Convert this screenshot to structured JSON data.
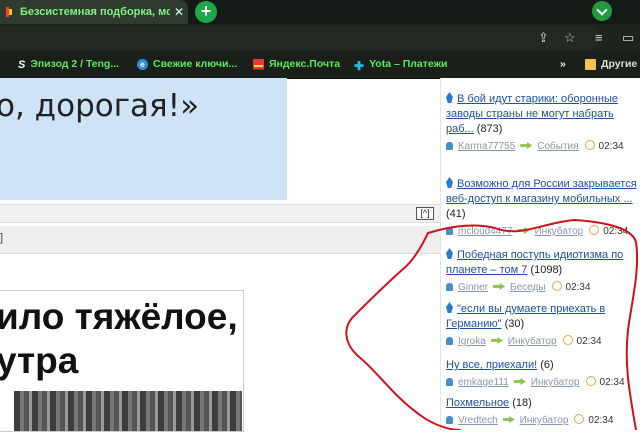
{
  "tab": {
    "title": "Безсистемная подборка, мо",
    "close": "✕"
  },
  "newtab": "+",
  "bookmarks": [
    {
      "label": "Эпизод 2 / Teng...",
      "icon": "s-icon"
    },
    {
      "label": "Свежие ключи...",
      "icon": "e-icon"
    },
    {
      "label": "Яндекс.Почта",
      "icon": "mail-icon"
    },
    {
      "label": "Yota – Платежи",
      "icon": "yota-icon"
    }
  ],
  "bookmarks_more": "»",
  "bookmarks_other": "Другие",
  "left": {
    "banner_text": "о, дорогая!»",
    "collapse": "[^]",
    "bracket": "]",
    "image_caption_line1": "ило тяжёлое,",
    "image_caption_line2": "утра"
  },
  "sidebar": {
    "items": [
      {
        "title": "В бой идут старики: оборонные заводы страны не могут набрать раб...",
        "count": "(873)",
        "user": "Karma77755",
        "category": "События",
        "time": "02:34",
        "hot": true
      },
      {
        "title": "Возможно для России закрывается веб-доступ к магазину мобильных ...",
        "count": "(41)",
        "user": "mcloud4477",
        "category": "Инкубатор",
        "time": "02:34",
        "hot": true
      },
      {
        "title": "Победная поступь идиотизма по планете – том 7",
        "count": "(1098)",
        "user": "Ginner",
        "category": "Беседы",
        "time": "02:34",
        "hot": true
      },
      {
        "title": "\"если вы думаете приехать в Германию\"",
        "count": "(30)",
        "user": "Igroka",
        "category": "Инкубатор",
        "time": "02:34",
        "hot": true
      },
      {
        "title": "Ну все, приехали!",
        "count": "(6)",
        "user": "emkage111",
        "category": "Инкубатор",
        "time": "02:34",
        "hot": false
      },
      {
        "title": "Похмельное",
        "count": "(18)",
        "user": "Vredtech",
        "category": "Инкубатор",
        "time": "02:34",
        "hot": false
      }
    ]
  },
  "colors": {
    "accent": "#1e50a2",
    "annotation": "#d0121b",
    "tab_text": "#7ff27f"
  }
}
